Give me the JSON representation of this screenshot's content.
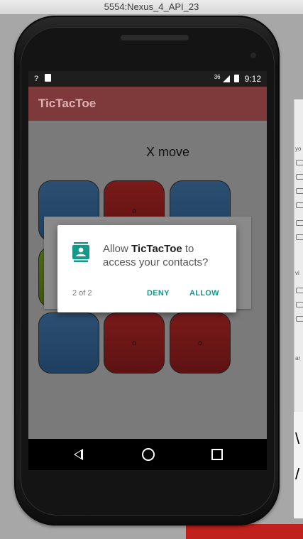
{
  "window": {
    "title": "5554:Nexus_4_API_23"
  },
  "status_bar": {
    "left_indicator": "?",
    "time": "9:12",
    "network_label": "36"
  },
  "app": {
    "title": "TicTacToe"
  },
  "game": {
    "status": "X move",
    "cells": [
      "",
      "o",
      "",
      "",
      "",
      "",
      "",
      "o",
      "o"
    ]
  },
  "dialog": {
    "prefix": "Allow ",
    "app_name": "TicTacToe",
    "suffix": " to access your contacts?",
    "counter": "2 of 2",
    "deny_label": "DENY",
    "allow_label": "ALLOW",
    "accent_color": "#11998a"
  },
  "icons": {
    "contacts": "contacts-icon",
    "back": "back-icon",
    "home": "home-icon",
    "recents": "recents-icon"
  },
  "colors": {
    "appbar": "#7e3a3a",
    "cell_blue": "#2b4f72",
    "cell_red": "#7a1a1a",
    "cell_green": "#4e6a12"
  }
}
